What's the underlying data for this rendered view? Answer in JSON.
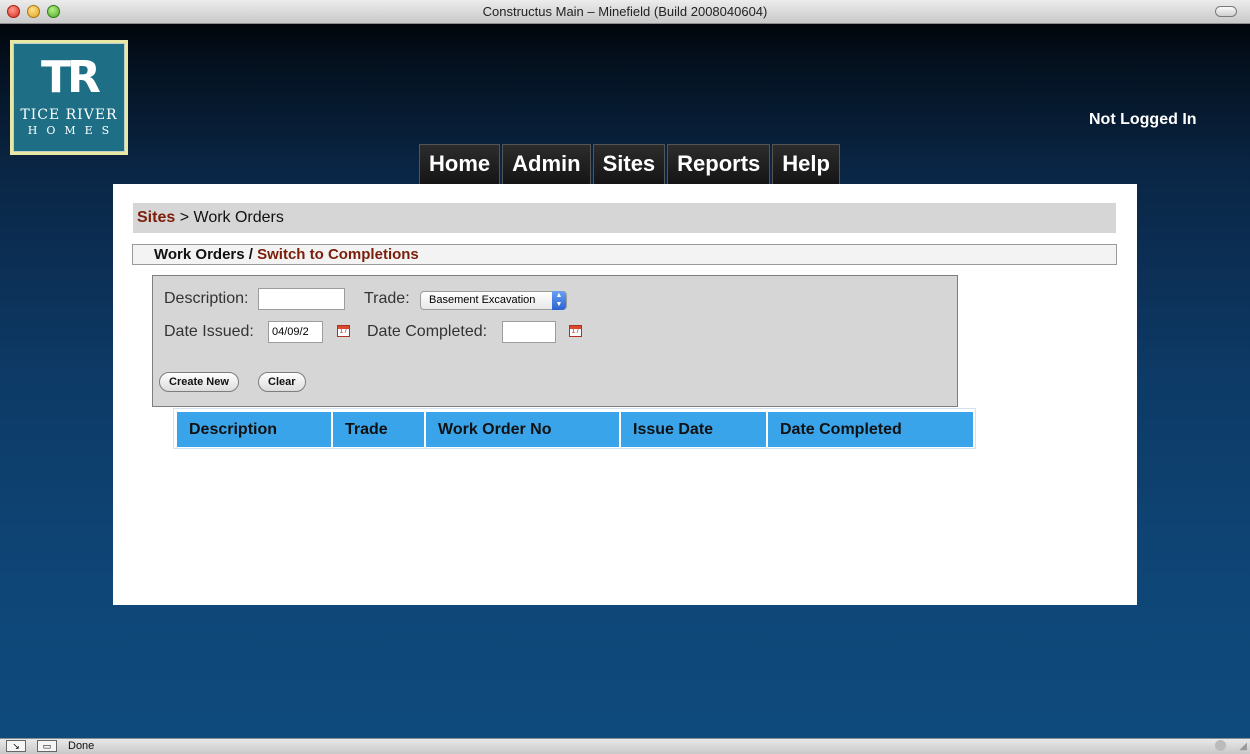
{
  "window": {
    "title": "Constructus Main – Minefield (Build 2008040604)"
  },
  "logo": {
    "mark": "TR",
    "name": "TICE RIVER",
    "sub": "HOMES"
  },
  "header": {
    "login_status": "Not Logged In"
  },
  "nav": {
    "tabs": [
      {
        "label": "Home"
      },
      {
        "label": "Admin"
      },
      {
        "label": "Sites"
      },
      {
        "label": "Reports"
      },
      {
        "label": "Help"
      }
    ]
  },
  "breadcrumb": {
    "link": "Sites",
    "separator": ">",
    "current": "Work Orders"
  },
  "subheader": {
    "current": "Work Orders",
    "separator": "/",
    "switch_link": "Switch to Completions"
  },
  "form": {
    "description_label": "Description:",
    "description_value": "",
    "trade_label": "Trade:",
    "trade_value": "Basement Excavation",
    "date_issued_label": "Date Issued:",
    "date_issued_value": "04/09/2",
    "date_completed_label": "Date Completed:",
    "date_completed_value": "",
    "calendar_glyph": "17",
    "create_label": "Create New",
    "clear_label": "Clear"
  },
  "table": {
    "columns": [
      "Description",
      "Trade",
      "Work Order No",
      "Issue Date",
      "Date Completed"
    ]
  },
  "status": {
    "text": "Done"
  },
  "colors": {
    "header_blue": "#3aa4ea",
    "link_maroon": "#7a1e0a",
    "logo_teal": "#1e6f85"
  }
}
